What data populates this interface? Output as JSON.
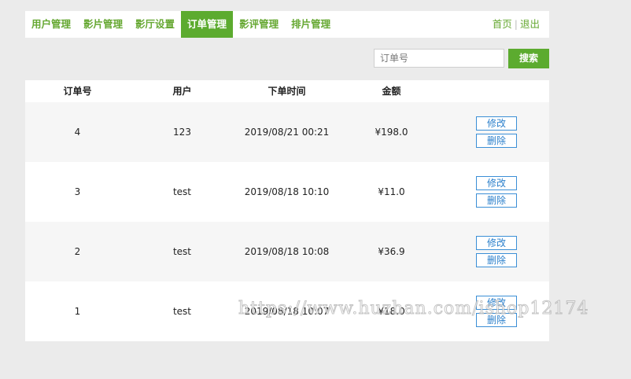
{
  "nav": {
    "tabs": [
      {
        "label": "用户管理",
        "active": false
      },
      {
        "label": "影片管理",
        "active": false
      },
      {
        "label": "影厅设置",
        "active": false
      },
      {
        "label": "订单管理",
        "active": true
      },
      {
        "label": "影评管理",
        "active": false
      },
      {
        "label": "排片管理",
        "active": false
      }
    ],
    "home_label": "首页",
    "separator": "|",
    "logout_label": "退出"
  },
  "search": {
    "placeholder": "订单号",
    "button_label": "搜索"
  },
  "table": {
    "columns": [
      "订单号",
      "用户",
      "下单时间",
      "金额",
      ""
    ],
    "rows": [
      {
        "order_id": "4",
        "user": "123",
        "time": "2019/08/21 00:21",
        "amount": "¥198.0"
      },
      {
        "order_id": "3",
        "user": "test",
        "time": "2019/08/18 10:10",
        "amount": "¥11.0"
      },
      {
        "order_id": "2",
        "user": "test",
        "time": "2019/08/18 10:08",
        "amount": "¥36.9"
      },
      {
        "order_id": "1",
        "user": "test",
        "time": "2019/08/18 10:07",
        "amount": "¥18.0"
      }
    ],
    "edit_label": "修改",
    "delete_label": "删除"
  },
  "watermark": "https://www.huzhan.com/ishop12174",
  "colors": {
    "brand_green": "#5cab2f",
    "action_blue": "#3b8fd6"
  }
}
